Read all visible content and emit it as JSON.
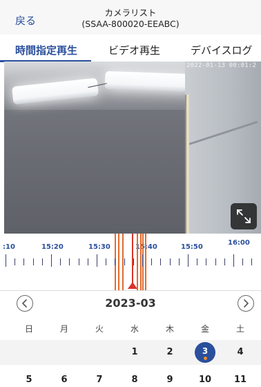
{
  "header": {
    "back_label": "戻る",
    "title_line1": "カメラリスト",
    "title_line2": "(SSAA-800020-EEABC)"
  },
  "tabs": [
    {
      "label": "時間指定再生",
      "active": true
    },
    {
      "label": "ビデオ再生",
      "active": false
    },
    {
      "label": "デバイスログ",
      "active": false
    }
  ],
  "video": {
    "timestamp": "2022-01-13 00:01:2",
    "fullscreen_icon": "expand-icon"
  },
  "timeline": {
    "labels": [
      ":10",
      "15:20",
      "15:30",
      "15:40",
      "15:50",
      "16:00"
    ],
    "colors": {
      "label": "#2a4f9c",
      "event": "#e46a2e",
      "marker": "#d9332a"
    }
  },
  "calendar": {
    "month": "2023-03",
    "prev_icon": "chevron-left-icon",
    "next_icon": "chevron-right-icon",
    "weekdays": [
      "日",
      "月",
      "火",
      "水",
      "木",
      "金",
      "土"
    ],
    "week1": [
      "",
      "",
      "",
      "1",
      "2",
      "3",
      "4"
    ],
    "week2": [
      "5",
      "6",
      "7",
      "8",
      "9",
      "10",
      "11"
    ],
    "selected_day": "3",
    "selected_color": "#2a4f9c",
    "dot_color": "#f08a2c"
  }
}
